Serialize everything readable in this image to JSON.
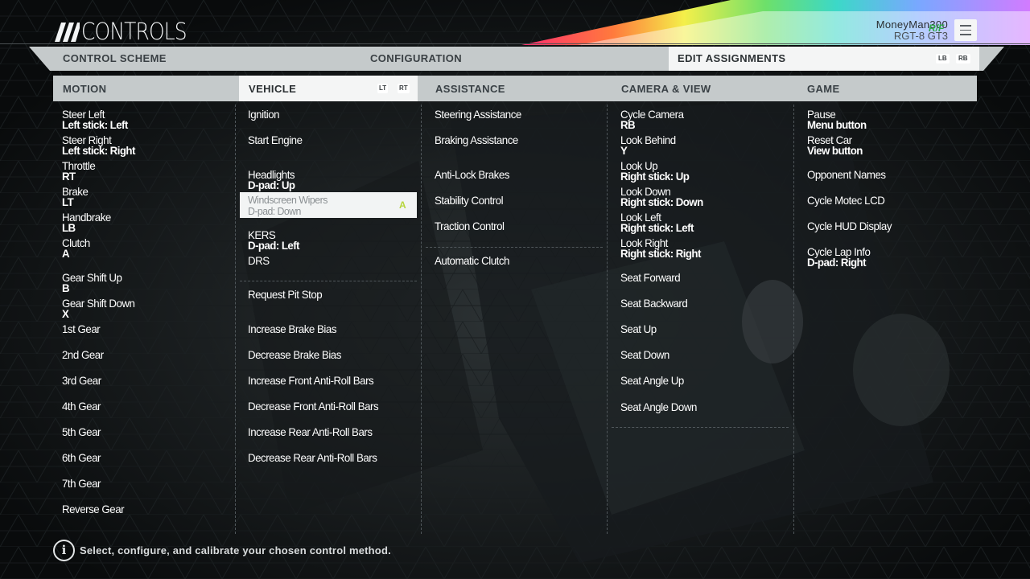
{
  "header": {
    "title": "CONTROLS",
    "profile_name": "MoneyMan300",
    "profile_car": "RGT-8 GT3",
    "brand_badge": "R/F"
  },
  "tabs": {
    "control_scheme": "CONTROL SCHEME",
    "configuration": "CONFIGURATION",
    "edit_assignments": "EDIT ASSIGNMENTS",
    "prev_key": "LB",
    "next_key": "RB",
    "active": "edit_assignments"
  },
  "categories": {
    "motion": "MOTION",
    "vehicle": "VEHICLE",
    "assistance": "ASSISTANCE",
    "camera": "CAMERA & VIEW",
    "game": "GAME",
    "prev_key": "LT",
    "next_key": "RT",
    "active": "vehicle"
  },
  "motion": [
    {
      "label": "Steer Left",
      "binding": "Left stick: Left"
    },
    {
      "label": "Steer Right",
      "binding": "Left stick: Right"
    },
    {
      "label": "Throttle",
      "binding": "RT"
    },
    {
      "label": "Brake",
      "binding": "LT"
    },
    {
      "label": "Handbrake",
      "binding": "LB"
    },
    {
      "label": "Clutch",
      "binding": "A"
    },
    {
      "label": "Gear Shift Up",
      "binding": "B"
    },
    {
      "label": "Gear Shift Down",
      "binding": "X"
    },
    {
      "label": "1st Gear",
      "binding": ""
    },
    {
      "label": "2nd Gear",
      "binding": ""
    },
    {
      "label": "3rd Gear",
      "binding": ""
    },
    {
      "label": "4th Gear",
      "binding": ""
    },
    {
      "label": "5th Gear",
      "binding": ""
    },
    {
      "label": "6th Gear",
      "binding": ""
    },
    {
      "label": "7th Gear",
      "binding": ""
    },
    {
      "label": "Reverse Gear",
      "binding": ""
    }
  ],
  "vehicle": [
    {
      "label": "Ignition",
      "binding": ""
    },
    {
      "label": "Start Engine",
      "binding": ""
    },
    {
      "label": "Headlights",
      "binding": "D-pad: Up"
    },
    {
      "label": "Windscreen Wipers",
      "binding": "D-pad: Down",
      "selected": true,
      "action_key": "A"
    },
    {
      "label": "KERS",
      "binding": "D-pad: Left"
    },
    {
      "label": "DRS",
      "binding": ""
    },
    {
      "label": "Request Pit Stop",
      "binding": ""
    },
    {
      "label": "Increase Brake Bias",
      "binding": ""
    },
    {
      "label": "Decrease Brake Bias",
      "binding": ""
    },
    {
      "label": "Increase Front Anti-Roll Bars",
      "binding": ""
    },
    {
      "label": "Decrease Front Anti-Roll Bars",
      "binding": ""
    },
    {
      "label": "Increase Rear Anti-Roll Bars",
      "binding": ""
    },
    {
      "label": "Decrease Rear Anti-Roll Bars",
      "binding": ""
    }
  ],
  "assistance": [
    {
      "label": "Steering Assistance",
      "binding": ""
    },
    {
      "label": "Braking Assistance",
      "binding": ""
    },
    {
      "label": "Anti-Lock Brakes",
      "binding": ""
    },
    {
      "label": "Stability Control",
      "binding": ""
    },
    {
      "label": "Traction Control",
      "binding": ""
    },
    {
      "label": "Automatic Clutch",
      "binding": ""
    }
  ],
  "camera": [
    {
      "label": "Cycle Camera",
      "binding": "RB"
    },
    {
      "label": "Look Behind",
      "binding": "Y"
    },
    {
      "label": "Look Up",
      "binding": "Right stick: Up"
    },
    {
      "label": "Look Down",
      "binding": "Right stick: Down"
    },
    {
      "label": "Look Left",
      "binding": "Right stick: Left"
    },
    {
      "label": "Look Right",
      "binding": "Right stick: Right"
    },
    {
      "label": "Seat Forward",
      "binding": ""
    },
    {
      "label": "Seat Backward",
      "binding": ""
    },
    {
      "label": "Seat Up",
      "binding": ""
    },
    {
      "label": "Seat Down",
      "binding": ""
    },
    {
      "label": "Seat Angle Up",
      "binding": ""
    },
    {
      "label": "Seat Angle Down",
      "binding": ""
    }
  ],
  "game": [
    {
      "label": "Pause",
      "binding": "Menu button"
    },
    {
      "label": "Reset Car",
      "binding": "View button"
    },
    {
      "label": "Opponent Names",
      "binding": ""
    },
    {
      "label": "Cycle Motec LCD",
      "binding": ""
    },
    {
      "label": "Cycle HUD Display",
      "binding": ""
    },
    {
      "label": "Cycle Lap Info",
      "binding": "D-pad: Right"
    }
  ],
  "footer": {
    "info_icon": "info-icon",
    "hint": "Select, configure, and calibrate your chosen control method."
  },
  "colors": {
    "panel": "#c5cacb",
    "active_tab": "#f4f5f5",
    "accent_key": "#b7d53c",
    "background": "#0b0d0e"
  }
}
